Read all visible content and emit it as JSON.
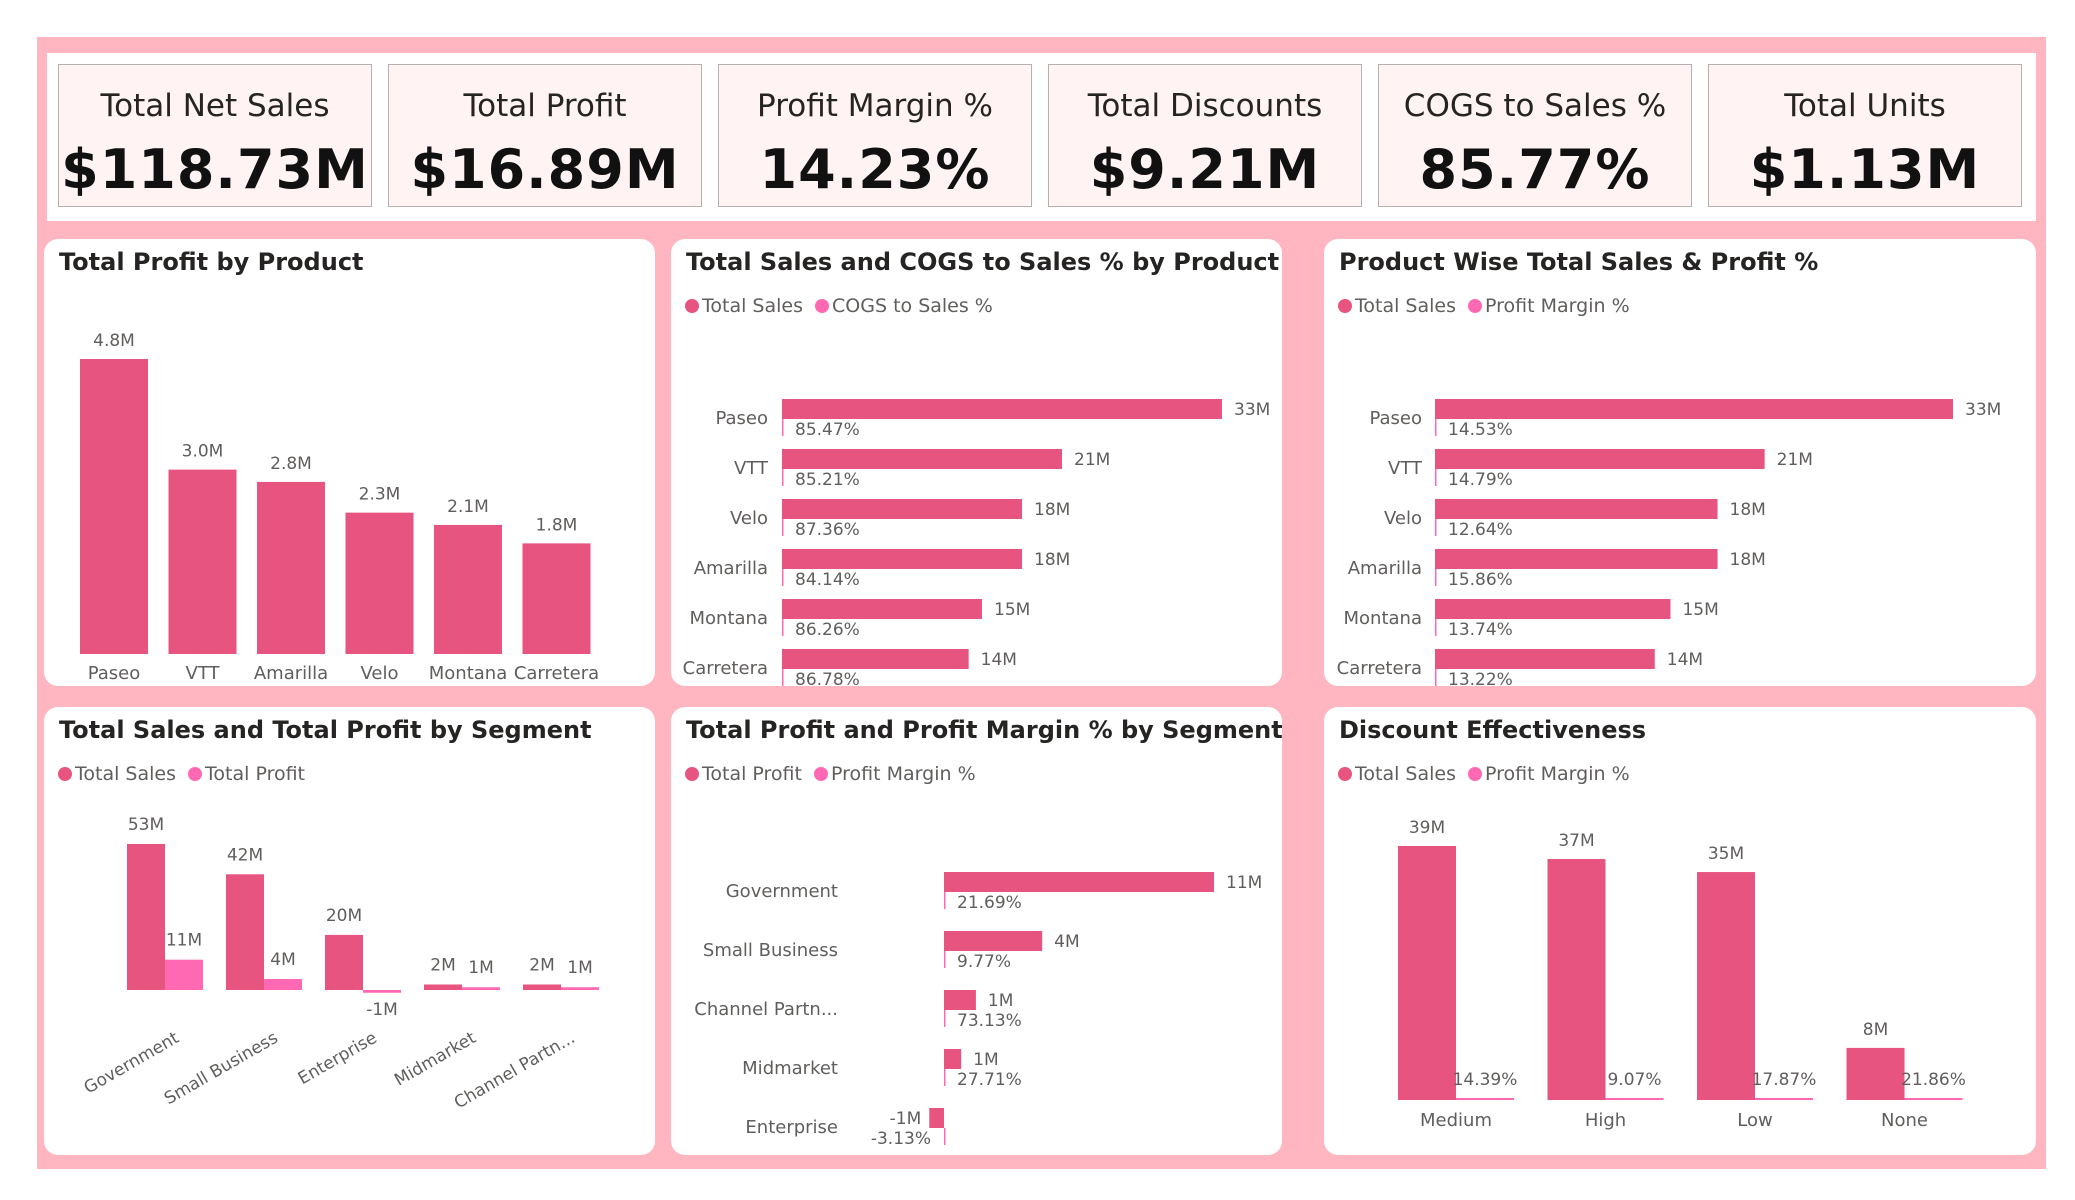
{
  "colors": {
    "primary": "#e75480",
    "secondary": "#ff69b4",
    "background": "#ffb6c1",
    "kpi_card_bg": "#fff3f4"
  },
  "kpis": [
    {
      "title": "Total Net Sales",
      "value": "$118.73M"
    },
    {
      "title": "Total Profit",
      "value": "$16.89M"
    },
    {
      "title": "Profit Margin %",
      "value": "14.23%"
    },
    {
      "title": "Total Discounts",
      "value": "$9.21M"
    },
    {
      "title": "COGS to Sales %",
      "value": "85.77%"
    },
    {
      "title": "Total Units",
      "value": "$1.13M"
    }
  ],
  "panels": {
    "profit_by_product": {
      "title": "Total Profit by Product"
    },
    "sales_cogs_by_product": {
      "title": "Total Sales and COGS to Sales % by Product",
      "legend": [
        "Total Sales",
        "COGS to Sales %"
      ]
    },
    "sales_profit_pct_by_product": {
      "title": "Product Wise Total Sales & Profit %",
      "legend": [
        "Total Sales",
        "Profit Margin %"
      ]
    },
    "sales_profit_by_segment": {
      "title": "Total Sales and Total Profit by Segment",
      "legend": [
        "Total Sales",
        "Total Profit"
      ]
    },
    "profit_margin_by_segment": {
      "title": "Total Profit and Profit Margin % by Segment",
      "legend": [
        "Total Profit",
        "Profit Margin %"
      ]
    },
    "discount_effectiveness": {
      "title": "Discount Effectiveness",
      "legend": [
        "Total Sales",
        "Profit Margin %"
      ]
    }
  },
  "chart_data": [
    {
      "id": "profit_by_product",
      "type": "bar",
      "title": "Total Profit by Product",
      "categories": [
        "Paseo",
        "VTT",
        "Amarilla",
        "Velo",
        "Montana",
        "Carretera"
      ],
      "values": [
        4.8,
        3.0,
        2.8,
        2.3,
        2.1,
        1.8
      ],
      "labels": [
        "4.8M",
        "3.0M",
        "2.8M",
        "2.3M",
        "2.1M",
        "1.8M"
      ],
      "ylim": [
        0,
        4.8
      ]
    },
    {
      "id": "sales_cogs_by_product",
      "type": "bar",
      "orientation": "horizontal",
      "title": "Total Sales and COGS to Sales % by Product",
      "categories": [
        "Paseo",
        "VTT",
        "Velo",
        "Amarilla",
        "Montana",
        "Carretera"
      ],
      "series": [
        {
          "name": "Total Sales",
          "values": [
            33,
            21,
            18,
            18,
            15,
            14
          ],
          "labels": [
            "33M",
            "21M",
            "18M",
            "18M",
            "15M",
            "14M"
          ]
        },
        {
          "name": "COGS to Sales %",
          "values": [
            85.47,
            85.21,
            87.36,
            84.14,
            86.26,
            86.78
          ],
          "labels": [
            "85.47%",
            "85.21%",
            "87.36%",
            "84.14%",
            "86.26%",
            "86.78%"
          ]
        }
      ],
      "legend": "top-left"
    },
    {
      "id": "sales_profit_pct_by_product",
      "type": "bar",
      "orientation": "horizontal",
      "title": "Product Wise Total Sales & Profit %",
      "categories": [
        "Paseo",
        "VTT",
        "Velo",
        "Amarilla",
        "Montana",
        "Carretera"
      ],
      "series": [
        {
          "name": "Total Sales",
          "values": [
            33,
            21,
            18,
            18,
            15,
            14
          ],
          "labels": [
            "33M",
            "21M",
            "18M",
            "18M",
            "15M",
            "14M"
          ]
        },
        {
          "name": "Profit Margin %",
          "values": [
            14.53,
            14.79,
            12.64,
            15.86,
            13.74,
            13.22
          ],
          "labels": [
            "14.53%",
            "14.79%",
            "12.64%",
            "15.86%",
            "13.74%",
            "13.22%"
          ]
        }
      ],
      "legend": "top-left"
    },
    {
      "id": "sales_profit_by_segment",
      "type": "bar",
      "title": "Total Sales and Total Profit by Segment",
      "categories": [
        "Government",
        "Small Business",
        "Enterprise",
        "Midmarket",
        "Channel Partn..."
      ],
      "series": [
        {
          "name": "Total Sales",
          "values": [
            53,
            42,
            20,
            2,
            2
          ],
          "labels": [
            "53M",
            "42M",
            "20M",
            "2M",
            "2M"
          ]
        },
        {
          "name": "Total Profit",
          "values": [
            11,
            4,
            -1,
            1,
            1
          ],
          "labels": [
            "11M",
            "4M",
            "-1M",
            "1M",
            "1M"
          ]
        }
      ],
      "legend": "top-left"
    },
    {
      "id": "profit_margin_by_segment",
      "type": "bar",
      "orientation": "horizontal",
      "title": "Total Profit and Profit Margin % by Segment",
      "categories": [
        "Government",
        "Small Business",
        "Channel Partn...",
        "Midmarket",
        "Enterprise"
      ],
      "series": [
        {
          "name": "Total Profit",
          "values": [
            11,
            4,
            1.3,
            0.7,
            -0.6
          ],
          "labels": [
            "11M",
            "4M",
            "1M",
            "1M",
            "-1M"
          ]
        },
        {
          "name": "Profit Margin %",
          "values": [
            21.69,
            9.77,
            73.13,
            27.71,
            -3.13
          ],
          "labels": [
            "21.69%",
            "9.77%",
            "73.13%",
            "27.71%",
            "-3.13%"
          ]
        }
      ],
      "legend": "top-left"
    },
    {
      "id": "discount_effectiveness",
      "type": "bar",
      "title": "Discount Effectiveness",
      "categories": [
        "Medium",
        "High",
        "Low",
        "None"
      ],
      "series": [
        {
          "name": "Total Sales",
          "values": [
            39,
            37,
            35,
            8
          ],
          "labels": [
            "39M",
            "37M",
            "35M",
            "8M"
          ]
        },
        {
          "name": "Profit Margin %",
          "values": [
            14.39,
            9.07,
            17.87,
            21.86
          ],
          "labels": [
            "14.39%",
            "9.07%",
            "17.87%",
            "21.86%"
          ]
        }
      ],
      "legend": "top-left"
    }
  ]
}
